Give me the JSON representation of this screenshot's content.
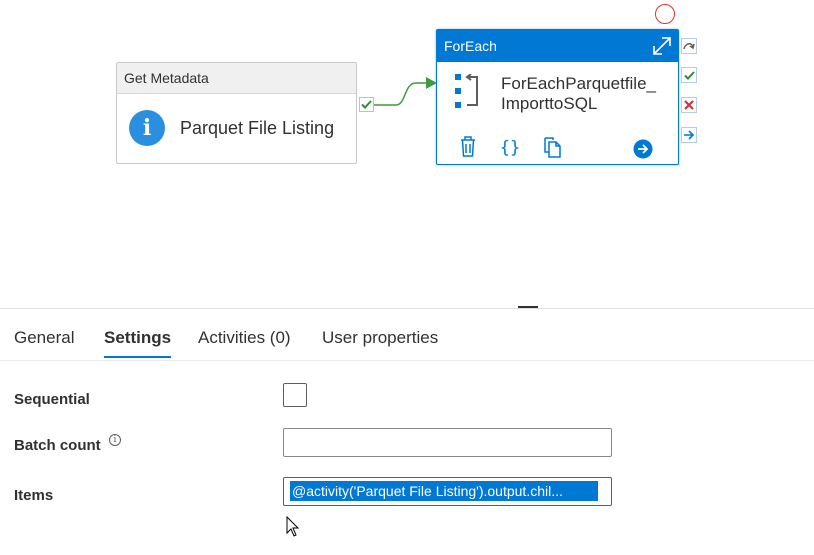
{
  "canvas": {
    "get_metadata": {
      "type_label": "Get Metadata",
      "name": "Parquet File Listing",
      "icon": "info-icon"
    },
    "foreach": {
      "type_label": "ForEach",
      "name_line1": "ForEachParquetfile_",
      "name_line2": "ImporttoSQL",
      "icons": [
        "foreach-loop-icon",
        "delete-icon",
        "code-icon",
        "copy-icon",
        "go-icon",
        "expand-icon"
      ]
    },
    "side_icons": [
      "skip-icon",
      "success-icon",
      "failure-icon",
      "completion-icon"
    ]
  },
  "panel": {
    "tabs": [
      {
        "label": "General",
        "active": false
      },
      {
        "label": "Settings",
        "active": true
      },
      {
        "label": "Activities (0)",
        "active": false
      },
      {
        "label": "User properties",
        "active": false
      }
    ],
    "fields": {
      "sequential_label": "Sequential",
      "batch_count_label": "Batch count",
      "batch_count_value": "",
      "items_label": "Items",
      "items_value": "@activity('Parquet File Listing').output.chil..."
    }
  },
  "colors": {
    "accent": "#0078d4",
    "connector": "#3d9c3d",
    "failure": "#d13438"
  }
}
